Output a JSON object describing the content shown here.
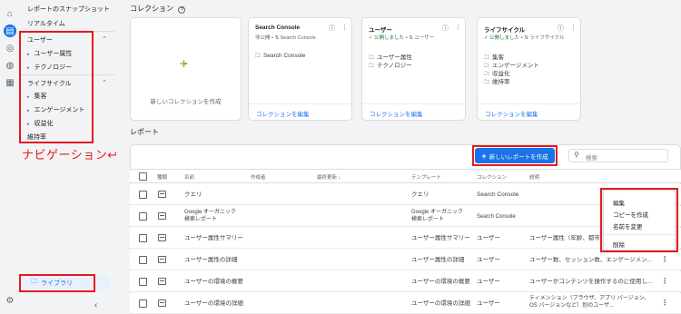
{
  "rail": {
    "icons": [
      "home-icon",
      "reports-icon",
      "explore-icon",
      "advertising-icon",
      "configure-icon",
      "settings-icon"
    ]
  },
  "nav": {
    "snapshot": "レポートのスナップショット",
    "realtime": "リアルタイム",
    "user_section": {
      "label": "ユーザー",
      "items": [
        "ユーザー属性",
        "テクノロジー"
      ]
    },
    "lifecycle_section": {
      "label": "ライフサイクル",
      "items": [
        "集客",
        "エンゲージメント",
        "収益化",
        "維持率"
      ]
    },
    "annotation": "ナビゲーション↩",
    "library": "ライブラリ",
    "collapse": "‹"
  },
  "collections": {
    "title": "コレクション",
    "help": "?",
    "new_label": "新しいコレクションを作成",
    "cards": [
      {
        "title": "Search Console",
        "status": "非公開",
        "template": "Search Console",
        "items": [
          "Search Console"
        ],
        "edit": "コレクションを編集",
        "published": false
      },
      {
        "title": "ユーザー",
        "status": "公開しました",
        "template": "ユーザー",
        "items": [
          "ユーザー属性",
          "テクノロジー"
        ],
        "edit": "コレクションを編集",
        "published": true
      },
      {
        "title": "ライフサイクル",
        "status": "公開しました",
        "template": "ライフサイクル",
        "items": [
          "集客",
          "エンゲージメント",
          "収益化",
          "維持率"
        ],
        "edit": "コレクションを編集",
        "published": true
      }
    ]
  },
  "reports": {
    "title": "レポート",
    "new_button": "新しいレポートを作成",
    "search_placeholder": "検索",
    "columns": [
      "種類",
      "名前",
      "作成者",
      "最終更新 ↓",
      "テンプレート",
      "コレクション",
      "説明"
    ],
    "rows": [
      {
        "name": "クエリ",
        "template": "クエリ",
        "collection": "Search Console",
        "desc": ""
      },
      {
        "name": "Google オーガニック検索レポート",
        "template": "Google オーガニック検索レポート",
        "collection": "Search Console",
        "desc": ""
      },
      {
        "name": "ユーザー属性サマリー",
        "template": "ユーザー属性サマリー",
        "collection": "ユーザー",
        "desc": "ユーザー属性（年齢、都市、国..."
      },
      {
        "name": "ユーザー属性の詳細",
        "template": "ユーザー属性の詳細",
        "collection": "ユーザー",
        "desc": "ユーザー数、セッション数、エンゲージメン..."
      },
      {
        "name": "ユーザーの環境の概要",
        "template": "ユーザーの環境の概要",
        "collection": "ユーザー",
        "desc": "ユーザーがコンテンツを操作するのに使用し..."
      },
      {
        "name": "ユーザーの環境の詳細",
        "template": "ユーザーの環境の詳細",
        "collection": "ユーザー",
        "desc": "ディメンション（ブラウザ、アプリ バージョン、OS バージョンなど）別のユーザ..."
      }
    ]
  },
  "context_menu": {
    "items": [
      "編集",
      "コピーを作成",
      "名前を変更",
      "削除"
    ]
  },
  "colors": {
    "accent": "#1a73e8",
    "annotation_red": "#e8191d"
  }
}
